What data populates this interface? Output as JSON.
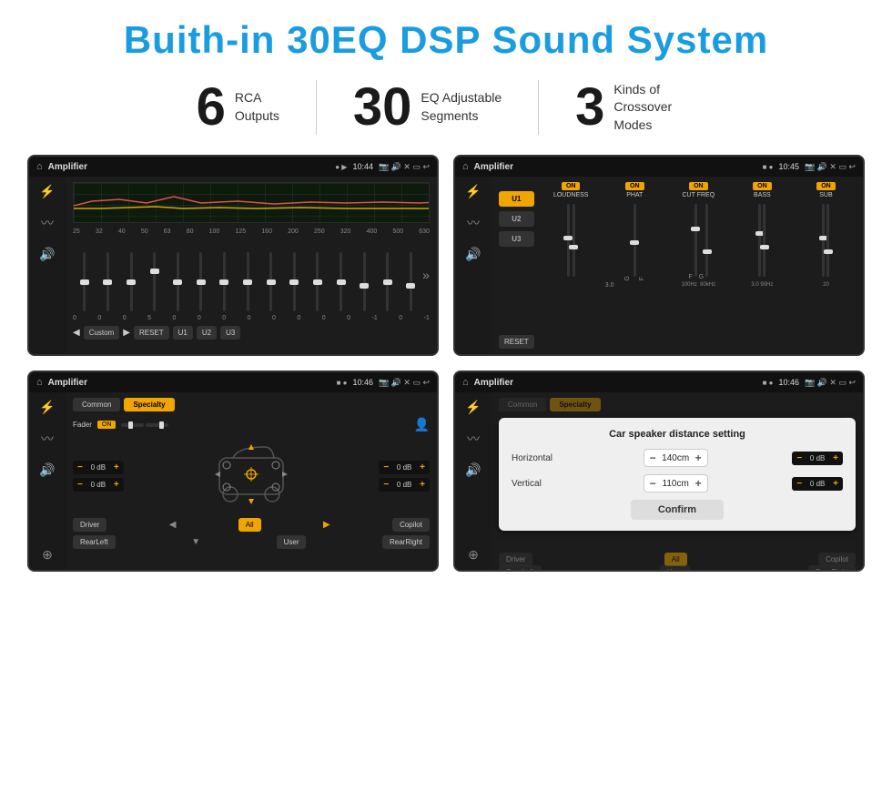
{
  "page": {
    "title": "Buith-in 30EQ DSP Sound System",
    "stats": [
      {
        "number": "6",
        "text": "RCA\nOutputs"
      },
      {
        "number": "30",
        "text": "EQ Adjustable\nSegments"
      },
      {
        "number": "3",
        "text": "Kinds of\nCrossover Modes"
      }
    ]
  },
  "screens": [
    {
      "id": "screen1",
      "title": "Amplifier",
      "time": "10:44",
      "type": "eq",
      "freq_labels": [
        "25",
        "32",
        "40",
        "50",
        "63",
        "80",
        "100",
        "125",
        "160",
        "200",
        "250",
        "320",
        "400",
        "500",
        "630"
      ],
      "slider_values": [
        "0",
        "0",
        "0",
        "5",
        "0",
        "0",
        "0",
        "0",
        "0",
        "0",
        "0",
        "0",
        "-1",
        "0",
        "-1"
      ],
      "bottom_buttons": [
        "Custom",
        "RESET",
        "U1",
        "U2",
        "U3"
      ]
    },
    {
      "id": "screen2",
      "title": "Amplifier",
      "time": "10:45",
      "type": "crossover",
      "u_buttons": [
        "U1",
        "U2",
        "U3"
      ],
      "columns": [
        {
          "on": true,
          "label": "LOUDNESS"
        },
        {
          "on": true,
          "label": "PHAT"
        },
        {
          "on": true,
          "label": "CUT FREQ"
        },
        {
          "on": true,
          "label": "BASS"
        },
        {
          "on": true,
          "label": "SUB"
        }
      ],
      "reset_btn": "RESET"
    },
    {
      "id": "screen3",
      "title": "Amplifier",
      "time": "10:46",
      "type": "speaker",
      "tabs": [
        "Common",
        "Specialty"
      ],
      "fader_label": "Fader",
      "fader_on": "ON",
      "db_values": [
        "0 dB",
        "0 dB",
        "0 dB",
        "0 dB"
      ],
      "bottom_buttons": [
        "Driver",
        "Copilot",
        "RearLeft",
        "All",
        "User",
        "RearRight"
      ]
    },
    {
      "id": "screen4",
      "title": "Amplifier",
      "time": "10:46",
      "type": "dialog",
      "tabs": [
        "Common",
        "Specialty"
      ],
      "dialog_title": "Car speaker distance setting",
      "dialog_rows": [
        {
          "label": "Horizontal",
          "value": "140cm"
        },
        {
          "label": "Vertical",
          "value": "110cm"
        }
      ],
      "confirm_label": "Confirm",
      "db_values": [
        "0 dB",
        "0 dB"
      ],
      "bottom_buttons": [
        "Driver",
        "Copilot",
        "RearLeft",
        "All",
        "User",
        "RearRight"
      ]
    }
  ]
}
